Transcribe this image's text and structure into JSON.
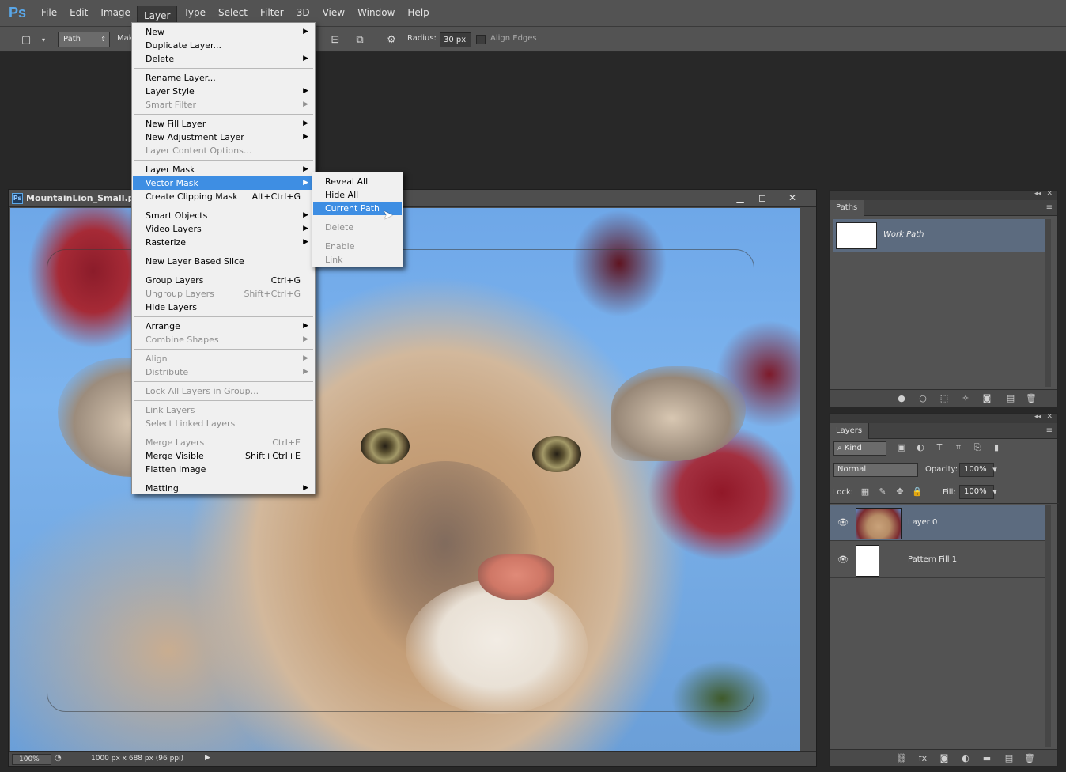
{
  "app": {
    "logo": "Ps"
  },
  "menubar": {
    "items": [
      "File",
      "Edit",
      "Image",
      "Layer",
      "Type",
      "Select",
      "Filter",
      "3D",
      "View",
      "Window",
      "Help"
    ],
    "active": "Layer"
  },
  "options": {
    "mode": "Path",
    "make_label": "Mak",
    "radius_label": "Radius:",
    "radius_value": "30 px",
    "align_edges": "Align Edges"
  },
  "document": {
    "title": "MountainLion_Small.psd",
    "zoom": "100%",
    "info": "1000 px x 688 px (96 ppi)"
  },
  "layer_menu": {
    "items": [
      {
        "label": "New",
        "arrow": true
      },
      {
        "label": "Duplicate Layer..."
      },
      {
        "label": "Delete",
        "arrow": true
      },
      {
        "label": "Rename Layer..."
      },
      {
        "label": "Layer Style",
        "arrow": true
      },
      {
        "label": "Smart Filter",
        "arrow": true,
        "disabled": true
      },
      {
        "label": "New Fill Layer",
        "arrow": true
      },
      {
        "label": "New Adjustment Layer",
        "arrow": true
      },
      {
        "label": "Layer Content Options...",
        "disabled": true
      },
      {
        "label": "Layer Mask",
        "arrow": true
      },
      {
        "label": "Vector Mask",
        "arrow": true,
        "highlight": true
      },
      {
        "label": "Create Clipping Mask",
        "shortcut": "Alt+Ctrl+G"
      },
      {
        "label": "Smart Objects",
        "arrow": true
      },
      {
        "label": "Video Layers",
        "arrow": true
      },
      {
        "label": "Rasterize",
        "arrow": true
      },
      {
        "label": "New Layer Based Slice"
      },
      {
        "label": "Group Layers",
        "shortcut": "Ctrl+G"
      },
      {
        "label": "Ungroup Layers",
        "shortcut": "Shift+Ctrl+G",
        "disabled": true
      },
      {
        "label": "Hide Layers"
      },
      {
        "label": "Arrange",
        "arrow": true
      },
      {
        "label": "Combine Shapes",
        "arrow": true,
        "disabled": true
      },
      {
        "label": "Align",
        "arrow": true,
        "disabled": true
      },
      {
        "label": "Distribute",
        "arrow": true,
        "disabled": true
      },
      {
        "label": "Lock All Layers in Group...",
        "disabled": true
      },
      {
        "label": "Link Layers",
        "disabled": true
      },
      {
        "label": "Select Linked Layers",
        "disabled": true
      },
      {
        "label": "Merge Layers",
        "shortcut": "Ctrl+E",
        "disabled": true
      },
      {
        "label": "Merge Visible",
        "shortcut": "Shift+Ctrl+E"
      },
      {
        "label": "Flatten Image"
      },
      {
        "label": "Matting",
        "arrow": true
      }
    ]
  },
  "vector_mask_submenu": {
    "items": [
      {
        "label": "Reveal All"
      },
      {
        "label": "Hide All"
      },
      {
        "label": "Current Path",
        "highlight": true
      },
      {
        "label": "Delete",
        "disabled": true
      },
      {
        "label": "Enable",
        "disabled": true
      },
      {
        "label": "Link",
        "disabled": true
      }
    ]
  },
  "paths_panel": {
    "tab": "Paths",
    "items": [
      {
        "name": "Work Path"
      }
    ]
  },
  "layers_panel": {
    "tab": "Layers",
    "filter": "Kind",
    "blend_mode": "Normal",
    "opacity_label": "Opacity:",
    "opacity": "100%",
    "lock_label": "Lock:",
    "fill_label": "Fill:",
    "fill": "100%",
    "layers": [
      {
        "name": "Layer 0",
        "selected": true
      },
      {
        "name": "Pattern Fill 1",
        "selected": false
      }
    ]
  }
}
